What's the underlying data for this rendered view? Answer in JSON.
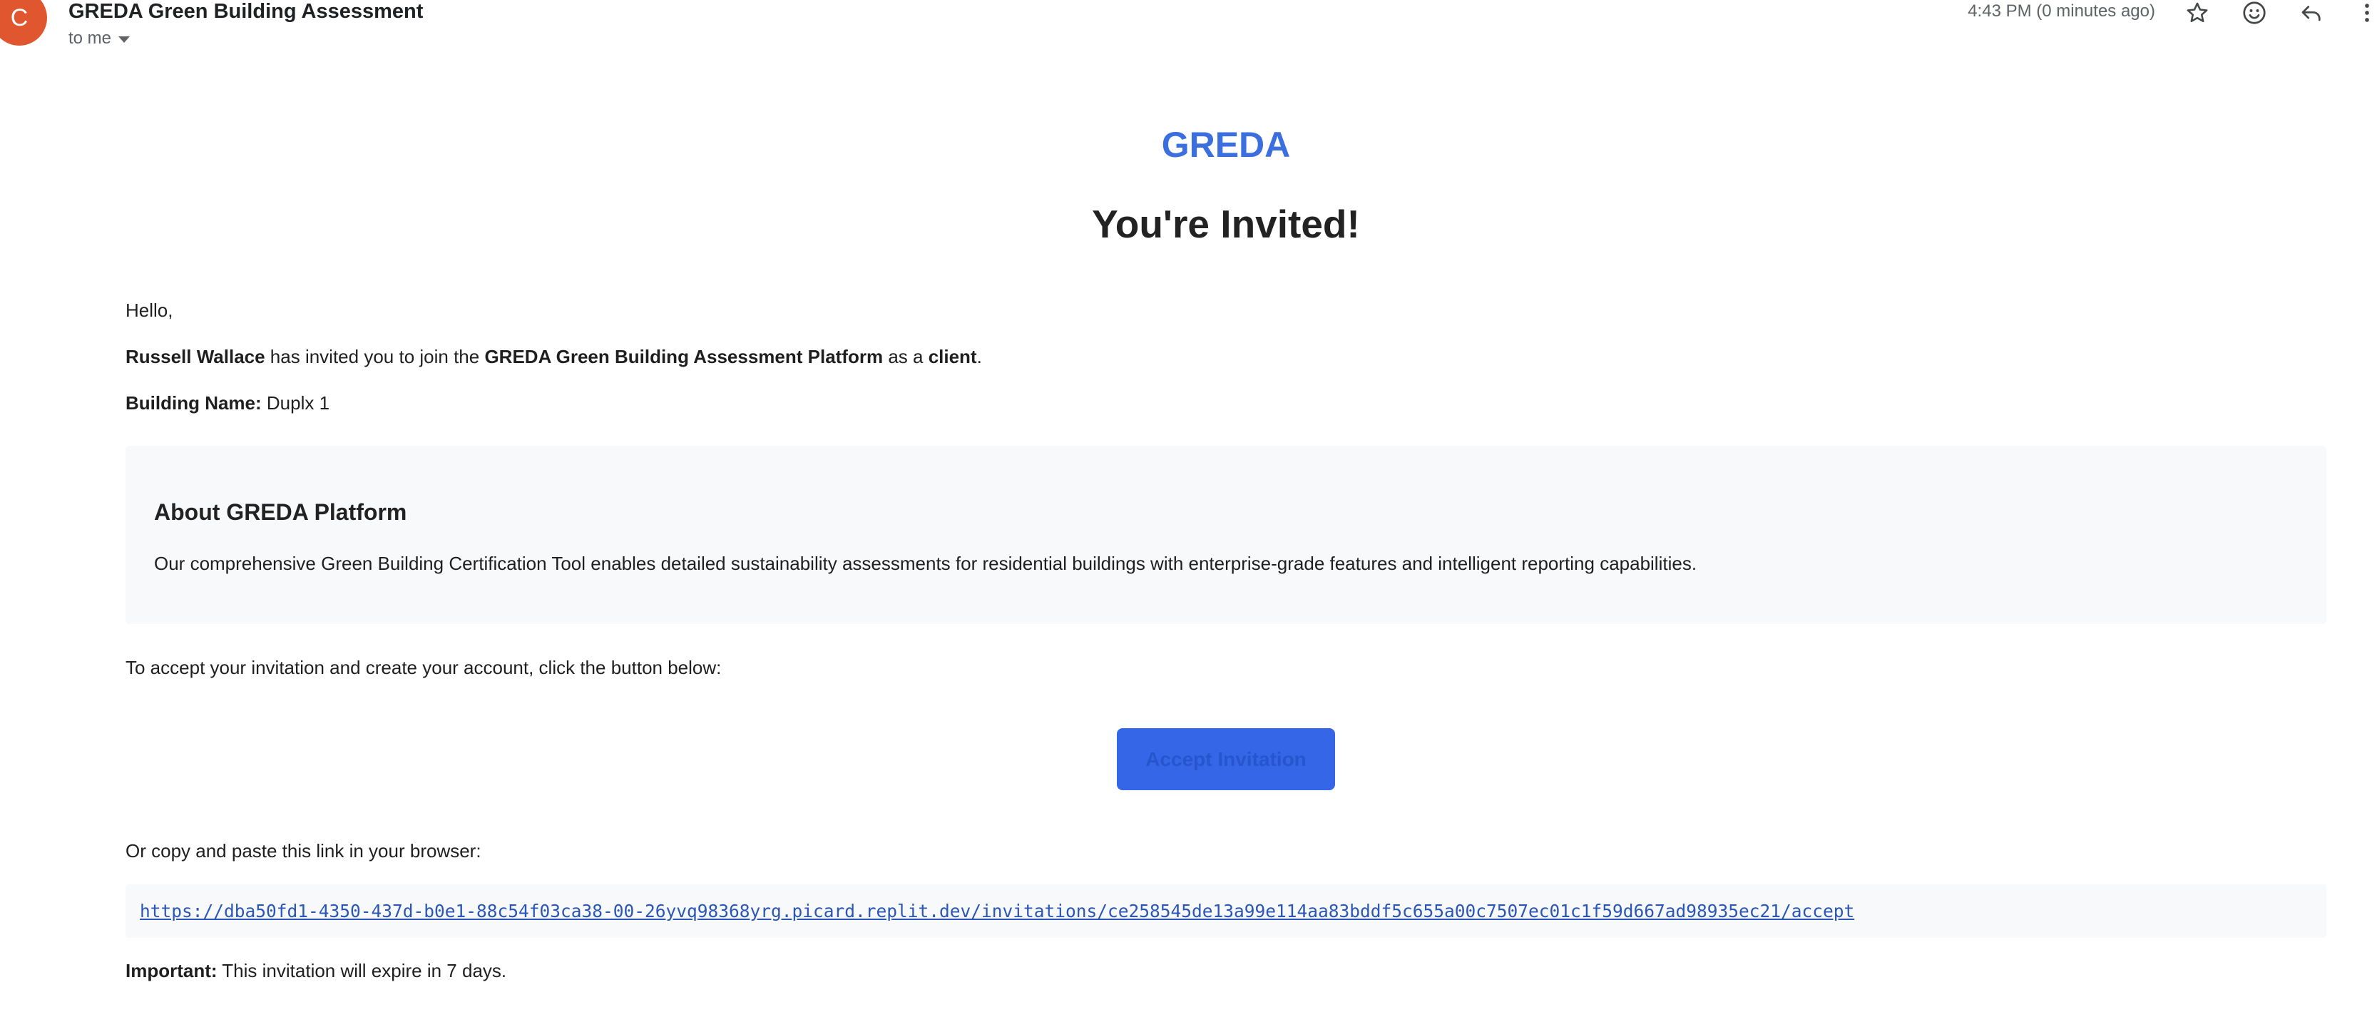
{
  "colors": {
    "avatar_bg": "#e0572f",
    "brand": "#3b6fe0",
    "button_bg": "#3566e8",
    "button_text": "#2556cc",
    "link": "#2a56b8",
    "panel_bg": "#f8f9fb"
  },
  "header": {
    "avatar_initial": "C",
    "subject": "GREDA Green Building Assessment",
    "recipient": "to me",
    "timestamp": "4:43 PM (0 minutes ago)",
    "icons": [
      "star-icon",
      "emoji-icon",
      "reply-icon",
      "more-vert-icon"
    ]
  },
  "email": {
    "brand": "GREDA",
    "heading": "You're Invited!",
    "greeting": "Hello,",
    "invite": {
      "inviter": "Russell Wallace",
      "text1": " has invited you to join the ",
      "platform": "GREDA Green Building Assessment Platform",
      "text2": " as a ",
      "role": "client",
      "text3": "."
    },
    "building": {
      "label": "Building Name:",
      "value": " Duplx 1"
    },
    "about": {
      "title": "About GREDA Platform",
      "description": "Our comprehensive Green Building Certification Tool enables detailed sustainability assessments for residential buildings with enterprise-grade features and intelligent reporting capabilities."
    },
    "accept_prompt": "To accept your invitation and create your account, click the button below:",
    "button_label": "Accept Invitation",
    "copy_prompt": "Or copy and paste this link in your browser:",
    "link": "https://dba50fd1-4350-437d-b0e1-88c54f03ca38-00-26yvq98368yrg.picard.replit.dev/invitations/ce258545de13a99e114aa83bddf5c655a00c7507ec01c1f59d667ad98935ec21/accept",
    "important": {
      "label": "Important:",
      "text": " This invitation will expire in 7 days."
    }
  }
}
